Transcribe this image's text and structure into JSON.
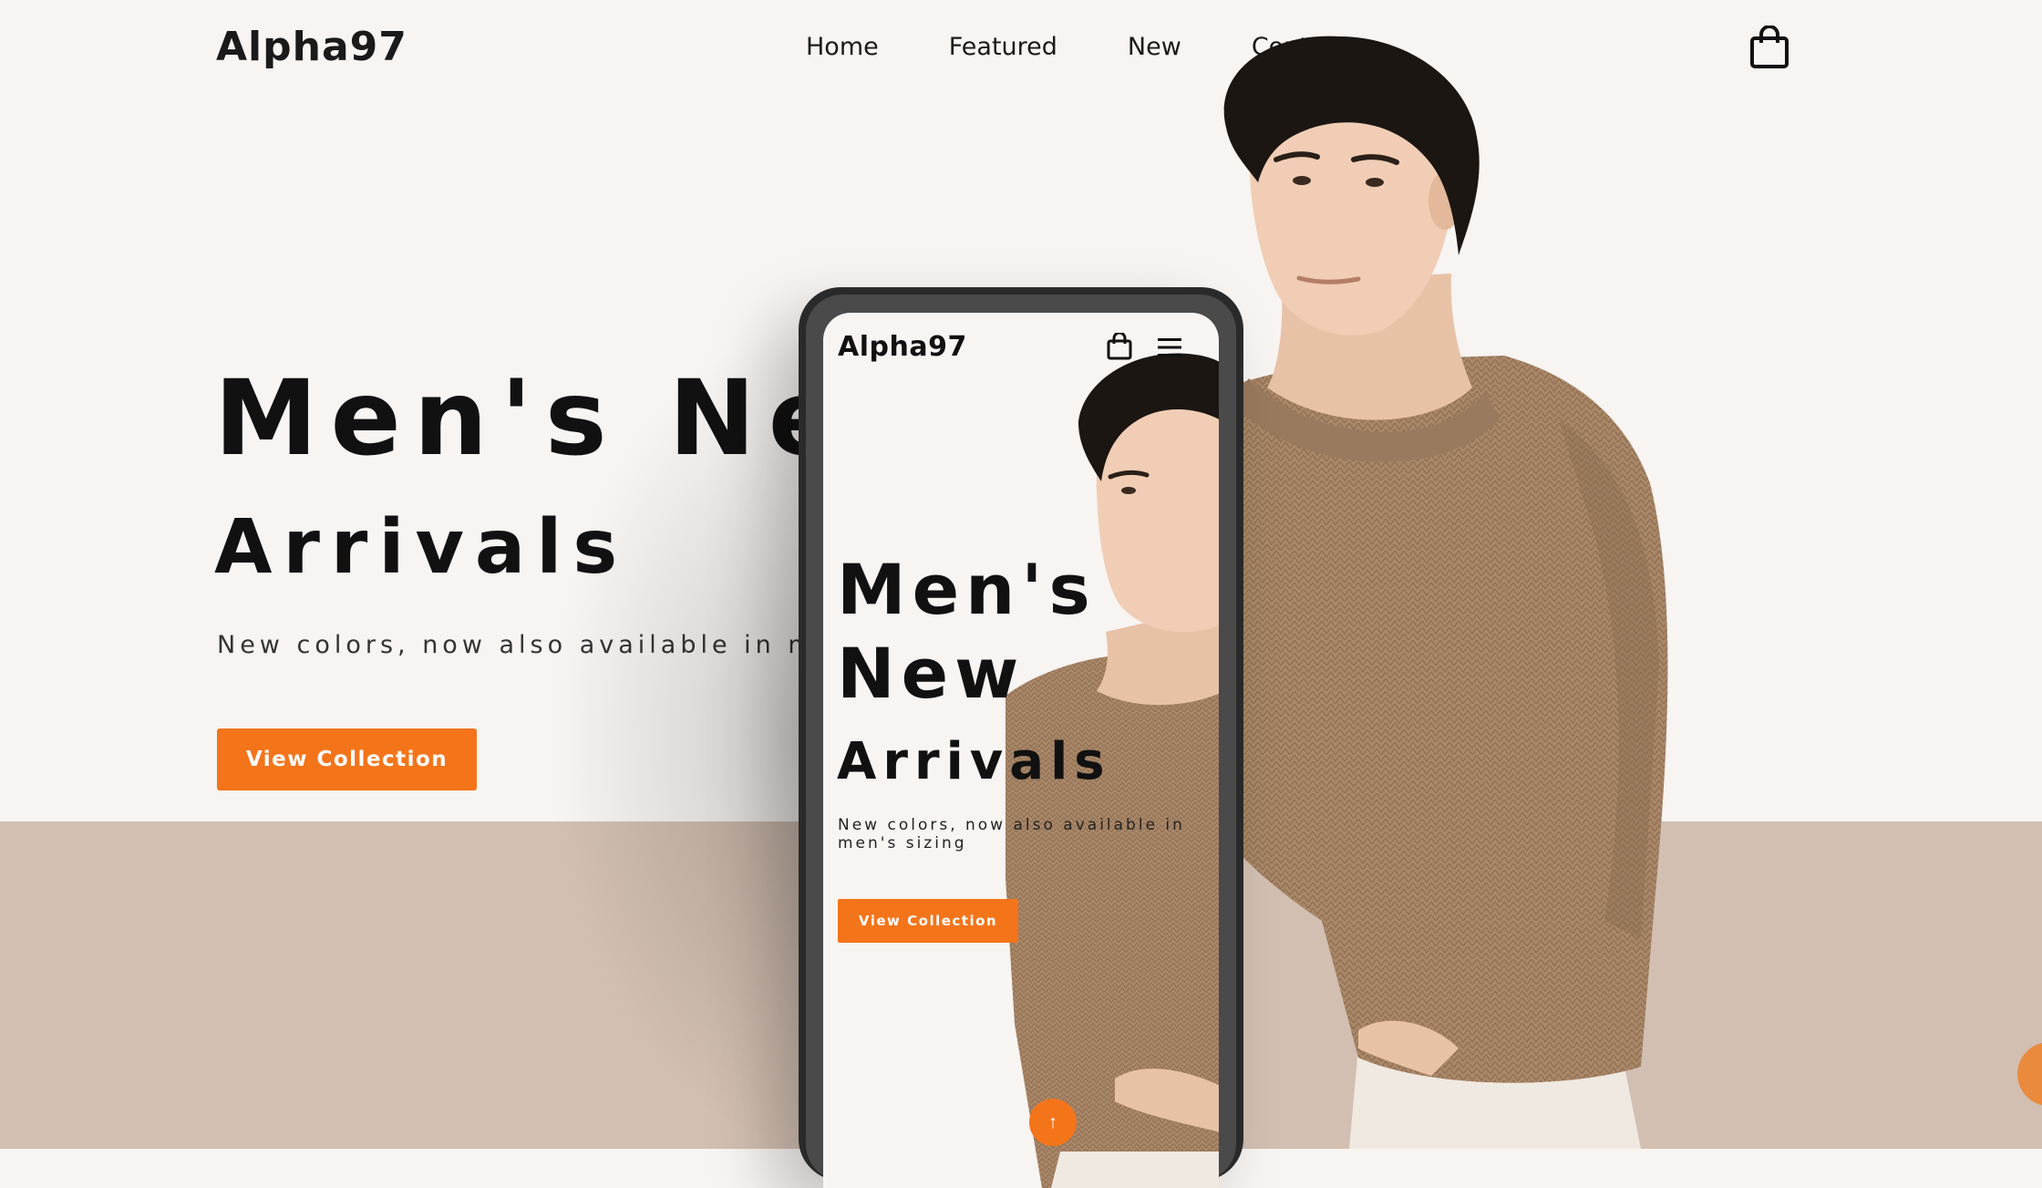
{
  "site": {
    "logo": "Alpha97",
    "nav": [
      {
        "label": "Home"
      },
      {
        "label": "Featured"
      },
      {
        "label": "New"
      },
      {
        "label": "Contact"
      }
    ],
    "cart_icon": "shopping-bag-icon"
  },
  "hero": {
    "title_line1": "Men's Ne",
    "title_line2": "Arrivals",
    "subtitle": "New colors, now also available in mer",
    "cta_label": "View Collection"
  },
  "mobile": {
    "logo": "Alpha97",
    "cart_icon": "shopping-bag-icon",
    "menu_icon": "hamburger-menu-icon",
    "title_line1": "Men's",
    "title_line2": "New",
    "title_line3": "Arrivals",
    "subtitle": "New colors, now also available in men's sizing",
    "cta_label": "View Collection",
    "scroll_top_icon": "arrow-up-icon"
  },
  "colors": {
    "accent": "#f4741a",
    "background": "#f7f4f2",
    "band": "#d2bfb2",
    "sweater": "#a98768"
  }
}
